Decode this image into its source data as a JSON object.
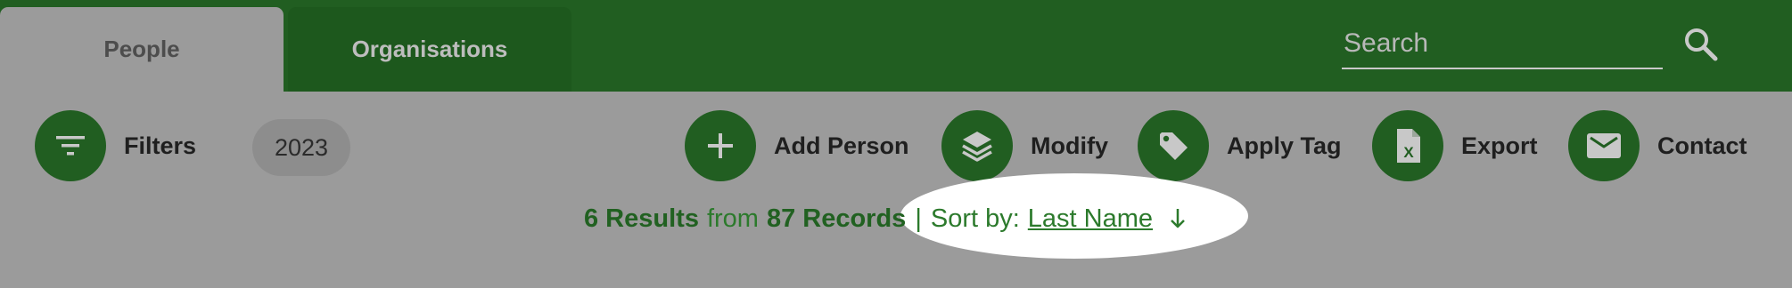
{
  "tabs": {
    "people": "People",
    "organisations": "Organisations"
  },
  "search": {
    "placeholder": "Search",
    "value": ""
  },
  "actions": {
    "filters": "Filters",
    "add_person": "Add Person",
    "modify": "Modify",
    "apply_tag": "Apply Tag",
    "export": "Export",
    "contact": "Contact"
  },
  "filter_chip": "2023",
  "results": {
    "count": "6 Results",
    "from_text": "from",
    "records": "87 Records",
    "separator": "|",
    "sort_label": "Sort by:",
    "sort_field": "Last Name",
    "sort_direction": "descending"
  },
  "icons": {
    "search": "search-icon",
    "filters": "filter-icon",
    "add": "plus-icon",
    "modify": "layers-icon",
    "tag": "tag-icon",
    "export": "excel-file-icon",
    "contact": "envelope-icon",
    "sort": "arrow-down-icon"
  },
  "colors": {
    "brand_green": "#215e21",
    "background": "#9b9b9b",
    "text_green": "#2c7a2c",
    "highlight": "#ffffff"
  }
}
